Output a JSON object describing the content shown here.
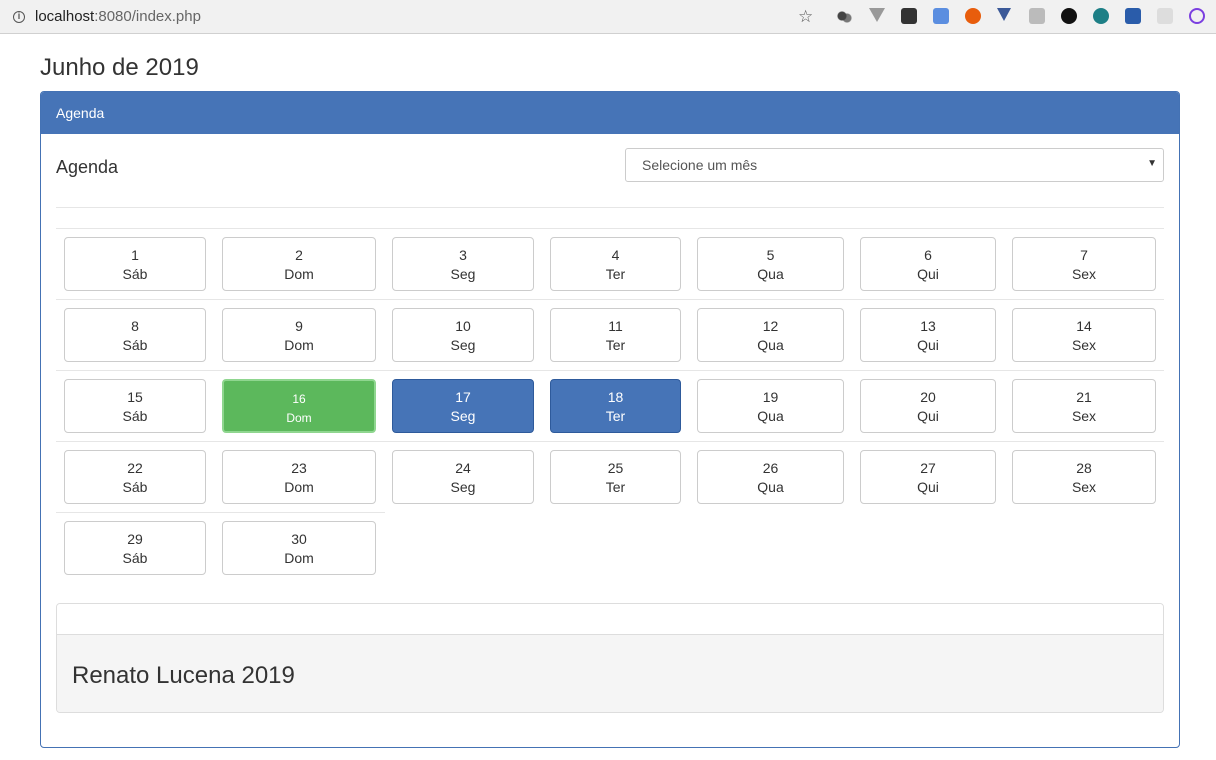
{
  "browser": {
    "url_host": "localhost",
    "url_rest": ":8080/index.php"
  },
  "page": {
    "title": "Junho de 2019"
  },
  "panel": {
    "heading": "Agenda",
    "agenda_label": "Agenda",
    "select_placeholder": "Selecione um mês"
  },
  "calendar": {
    "days": [
      {
        "num": "1",
        "wd": "Sáb",
        "state": "normal"
      },
      {
        "num": "2",
        "wd": "Dom",
        "state": "normal"
      },
      {
        "num": "3",
        "wd": "Seg",
        "state": "normal"
      },
      {
        "num": "4",
        "wd": "Ter",
        "state": "normal"
      },
      {
        "num": "5",
        "wd": "Qua",
        "state": "normal"
      },
      {
        "num": "6",
        "wd": "Qui",
        "state": "normal"
      },
      {
        "num": "7",
        "wd": "Sex",
        "state": "normal"
      },
      {
        "num": "8",
        "wd": "Sáb",
        "state": "normal"
      },
      {
        "num": "9",
        "wd": "Dom",
        "state": "normal"
      },
      {
        "num": "10",
        "wd": "Seg",
        "state": "normal"
      },
      {
        "num": "11",
        "wd": "Ter",
        "state": "normal"
      },
      {
        "num": "12",
        "wd": "Qua",
        "state": "normal"
      },
      {
        "num": "13",
        "wd": "Qui",
        "state": "normal"
      },
      {
        "num": "14",
        "wd": "Sex",
        "state": "normal"
      },
      {
        "num": "15",
        "wd": "Sáb",
        "state": "normal"
      },
      {
        "num": "16",
        "wd": "Dom",
        "state": "today"
      },
      {
        "num": "17",
        "wd": "Seg",
        "state": "selected"
      },
      {
        "num": "18",
        "wd": "Ter",
        "state": "selected"
      },
      {
        "num": "19",
        "wd": "Qua",
        "state": "normal"
      },
      {
        "num": "20",
        "wd": "Qui",
        "state": "normal"
      },
      {
        "num": "21",
        "wd": "Sex",
        "state": "normal"
      },
      {
        "num": "22",
        "wd": "Sáb",
        "state": "normal"
      },
      {
        "num": "23",
        "wd": "Dom",
        "state": "normal"
      },
      {
        "num": "24",
        "wd": "Seg",
        "state": "normal"
      },
      {
        "num": "25",
        "wd": "Ter",
        "state": "normal"
      },
      {
        "num": "26",
        "wd": "Qua",
        "state": "normal"
      },
      {
        "num": "27",
        "wd": "Qui",
        "state": "normal"
      },
      {
        "num": "28",
        "wd": "Sex",
        "state": "normal"
      },
      {
        "num": "29",
        "wd": "Sáb",
        "state": "normal"
      },
      {
        "num": "30",
        "wd": "Dom",
        "state": "normal"
      }
    ]
  },
  "footer": {
    "text": "Renato Lucena 2019"
  },
  "colors": {
    "primary": "#4674b7",
    "today": "#5cb85c"
  }
}
